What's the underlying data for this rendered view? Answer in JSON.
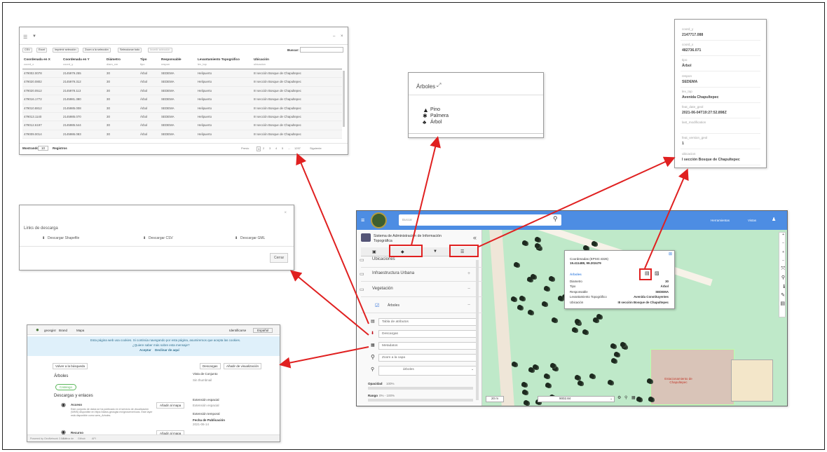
{
  "table_panel": {
    "toolbar": [
      "CSV",
      "Excel",
      "Imprimir selección",
      "Zoom a la selección",
      "Seleccionar todo",
      "Invertir selección"
    ],
    "search_label": "Buscar:",
    "columns": [
      {
        "title": "Coordenada en X",
        "sub": "coord_x"
      },
      {
        "title": "Coordenada en Y",
        "sub": "coord_y"
      },
      {
        "title": "Diámetro",
        "sub": "diam_cm"
      },
      {
        "title": "Tipo",
        "sub": "tipo"
      },
      {
        "title": "Responsable",
        "sub": "respon"
      },
      {
        "title": "Levantamiento Topográfico",
        "sub": "lev_top"
      },
      {
        "title": "Ubicación",
        "sub": "ubicacion"
      }
    ],
    "rows": [
      [
        "479002.0078",
        "2145979.255",
        "30",
        "Árbol",
        "SEDEMA",
        "Helipuerto",
        "III sección Bosque de Chapultepec"
      ],
      [
        "479020.0802",
        "2145979.312",
        "30",
        "Árbol",
        "SEDEMA",
        "Helipuerto",
        "III sección Bosque de Chapultepec"
      ],
      [
        "479020.0512",
        "2145978.113",
        "30",
        "Árbol",
        "SEDEMA",
        "Helipuerto",
        "III sección Bosque de Chapultepec"
      ],
      [
        "479016.1772",
        "2145981.380",
        "30",
        "Árbol",
        "SEDEMA",
        "Helipuerto",
        "III sección Bosque de Chapultepec"
      ],
      [
        "479010.8812",
        "2145985.008",
        "30",
        "Árbol",
        "SEDEMA",
        "Helipuerto",
        "III sección Bosque de Chapultepec"
      ],
      [
        "479013.1140",
        "2145985.070",
        "30",
        "Árbol",
        "SEDEMA",
        "Helipuerto",
        "III sección Bosque de Chapultepec"
      ],
      [
        "479012.6197",
        "2145985.544",
        "30",
        "Árbol",
        "SEDEMA",
        "Helipuerto",
        "III sección Bosque de Chapultepec"
      ],
      [
        "479009.0014",
        "2145986.083",
        "30",
        "Árbol",
        "SEDEMA",
        "Helipuerto",
        "III sección Bosque de Chapultepec"
      ]
    ],
    "footer_show": "Mostrando",
    "footer_count": "10",
    "footer_regs": "Registros",
    "pager": [
      "Previo",
      "1",
      "2",
      "3",
      "4",
      "5",
      "...",
      "1297",
      "Siguiente"
    ]
  },
  "legend_panel": {
    "title": "Árboles",
    "items": [
      "Pino",
      "Palmera",
      "Árbol"
    ]
  },
  "attr_panel": {
    "fields": [
      {
        "key": "coord_y",
        "value": "2147717.088"
      },
      {
        "key": "coord_x",
        "value": "482736.071"
      },
      {
        "key": "tipo",
        "value": "Árbol"
      },
      {
        "key": "respon",
        "value": "SEDEMA"
      },
      {
        "key": "lev_top",
        "value": "Avenida Chapultepec"
      },
      {
        "key": "feat_date_geol",
        "value": "2021-06-04T19:27:52.898Z"
      },
      {
        "key": "last_modification",
        "value": ""
      },
      {
        "key": "feat_version_geol",
        "value": "1"
      },
      {
        "key": "ubicacion",
        "value": "I sección Bosque de Chapultepec"
      }
    ]
  },
  "download_panel": {
    "title": "Links de descarga",
    "links": [
      "Descargar Shapefile",
      "Descargar CSV",
      "Descargar GML"
    ],
    "close": "Cerrar"
  },
  "metadata_panel": {
    "brand": "geosgisr",
    "nav": [
      "Brand",
      "Mapa"
    ],
    "user": "Identificarse",
    "lang": "Español",
    "banner": "Esta página web usa cookies. Si continúa navegando por esta página, asumiremos que acepta las cookies.",
    "banner2": "¿Quiere saber más sobre esta mensaje?",
    "banner_accept": "Aceptar",
    "banner_reject": "Declinar de aquí",
    "back": "Volver a la búsqueda",
    "layer_title": "Árboles",
    "pill": "Catalogo",
    "downloads_title": "Descargas y enlaces",
    "item1_title": "Acceso",
    "item1_text": "Este conjunto de datos se ha publicado en el servicio de visualización (WMS) disponible en https://datos.geosgisr.mx/geoserver/ows. Este layer está disponible como wms_Arboles.",
    "item1_btn": "Añadir al mapa",
    "item2_title": "Recurso",
    "item2_btn": "Añadir al mapa",
    "right_btns": [
      "Descargas",
      "Añadir de visualización"
    ],
    "vista": "Vista de Conjunto",
    "vista_sub": "Sin thumbnail",
    "ext_space": "Extensión espacial",
    "ext_space_sub": "Extensión espacial",
    "ext_time": "Extensión temporal",
    "pub": "Fecha de Publicación",
    "pub_date": "2021-06-14",
    "footer": [
      "Powered by GeoNetwork 3.8.0.0",
      "Acerca de",
      "Github",
      "API"
    ]
  },
  "app": {
    "search_placeholder": "Buscar",
    "menus": [
      "Herramientas",
      "Vistas"
    ],
    "title_line1": "Sistema de Administración de Información",
    "title_line2": "Topográfica",
    "layers": [
      {
        "label": "Ubicaciones",
        "sign": ""
      },
      {
        "label": "Infraestructura Urbana",
        "sign": "+"
      },
      {
        "label": "Vegetación",
        "sign": "−"
      },
      {
        "label": "Árboles",
        "sign": "−"
      }
    ],
    "options": [
      "Tabla de atributos",
      "Descargas",
      "Metadatos",
      "Zoom a la capa",
      "árboles"
    ],
    "opacity_label": "Opacidad",
    "opacity_value": "100%",
    "range_label": "Rango",
    "range_value": "0% - 100%",
    "popup": {
      "coords_label": "Coordenadas (EPSG:4326)",
      "coords": "19.411488, 99.202479",
      "layer": "Árboles",
      "rows": [
        {
          "k": "Diametro",
          "v": "30"
        },
        {
          "k": "Tipo",
          "v": "Árbol"
        },
        {
          "k": "Responsable",
          "v": "SEDEMA"
        },
        {
          "k": "Levantamiento Topográfico",
          "v": "Avenida Constituyentes"
        },
        {
          "k": "Ubicación",
          "v": "III sección Bosque de Chapultepec"
        }
      ]
    },
    "map_label": "Estacionamiento de Chapultepec",
    "scale": "20 m",
    "zoom_value": "9002.84",
    "colors": {
      "header": "#4d8de3",
      "map": "#bfe9c9",
      "red": "#e02020"
    }
  }
}
